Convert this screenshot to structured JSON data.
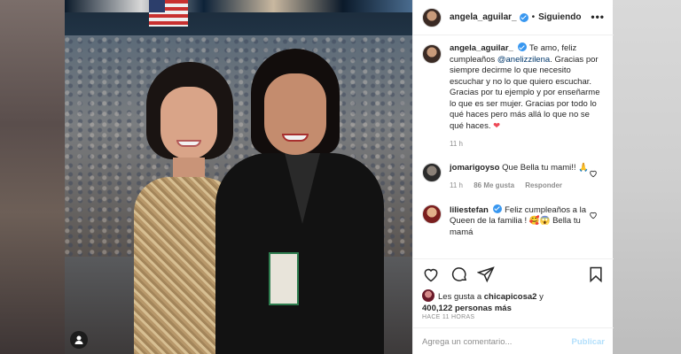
{
  "header": {
    "username": "angela_aguilar_",
    "separator": "•",
    "follow_status": "Siguiendo",
    "more": "•••"
  },
  "caption": {
    "username": "angela_aguilar_",
    "text_before": "Te amo, feliz cumpleaños",
    "mention": "@anelizzilena",
    "text_after": ". Gracias por siempre decirme lo que necesito escuchar y no lo que quiero escuchar. Gracias por tu ejemplo y por enseñarme lo que es ser mujer. Gracias por todo lo qué haces pero más allá lo que no se qué haces.",
    "emoji": "❤",
    "time": "11 h"
  },
  "comments": [
    {
      "username": "jomarigoyso",
      "text": "Que Bella tu mami!! 🙏",
      "time": "11 h",
      "likes": "86 Me gusta",
      "reply": "Responder"
    },
    {
      "username": "liliestefan",
      "text": "Feliz cumpleaños a la Queen de la familia ! 🥰😱 Bella tu mamá",
      "time": "",
      "likes": "",
      "reply": ""
    }
  ],
  "likes": {
    "prefix": "Les gusta a",
    "user": "chicapicosa2",
    "connector": "y",
    "count": "400,122 personas más"
  },
  "posted_ago": "HACE 11 HORAS",
  "add_comment": {
    "placeholder": "Agrega un comentario...",
    "post_label": "Publicar"
  },
  "colors": {
    "verified": "#3897f0",
    "mention": "#00376b",
    "post_disabled": "#b2dffc",
    "text": "#262626",
    "muted": "#8e8e8e"
  }
}
